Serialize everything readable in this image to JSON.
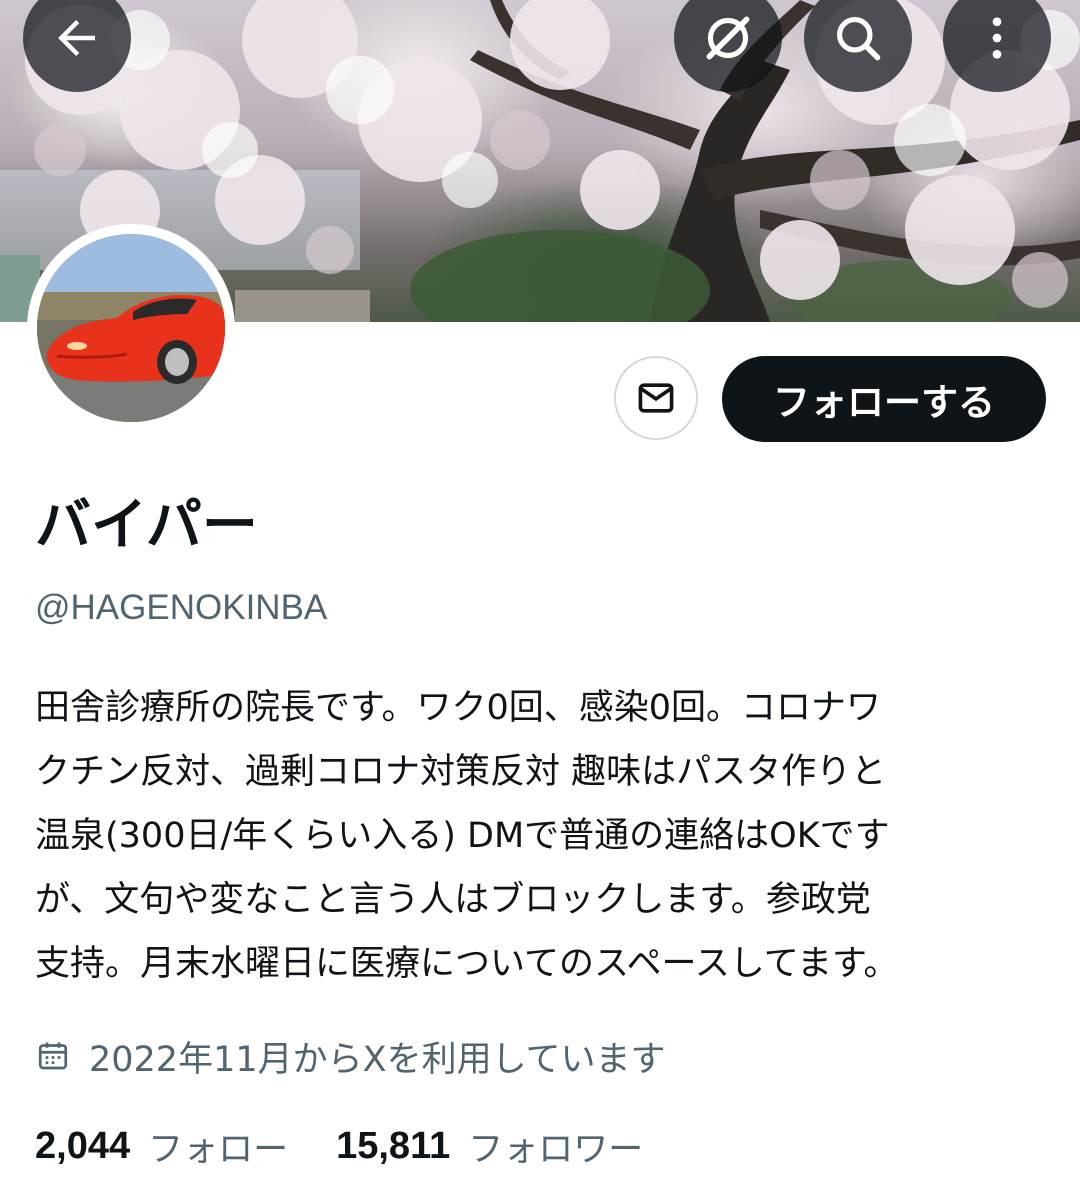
{
  "header": {
    "back_icon": "arrow-left-icon",
    "grok_icon": "grok-icon",
    "search_icon": "search-icon",
    "more_icon": "more-vertical-icon"
  },
  "profile": {
    "display_name": "バイパー",
    "handle": "@HAGENOKINBA",
    "bio_lines": [
      "田舎診療所の院長です。ワク0回、感染0回。コロナワ",
      "クチン反対、過剰コロナ対策反対 趣味はパスタ作りと",
      "温泉(300日/年くらい入る) DMで普通の連絡はOKです",
      "が、文句や変なこと言う人はブロックします。参政党",
      "支持。月末水曜日に医療についてのスペースしてます。"
    ],
    "joined": "2022年11月からXを利用しています",
    "following_count": "2,044",
    "following_label": "フォロー",
    "followers_count": "15,811",
    "followers_label": "フォロワー"
  },
  "actions": {
    "message_icon": "mail-icon",
    "follow_label": "フォローする"
  },
  "colors": {
    "text_primary": "#0f1419",
    "text_secondary": "#536471",
    "button_dark": "#0f1419",
    "border": "#cfd9de"
  }
}
